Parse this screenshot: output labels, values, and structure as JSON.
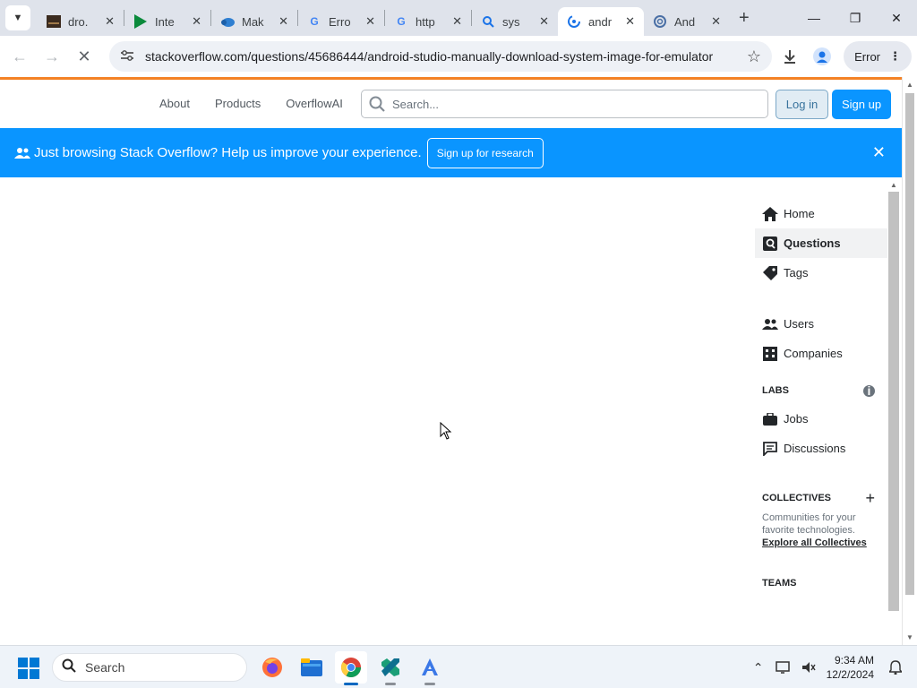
{
  "browser": {
    "tabs": [
      {
        "title": "dro.",
        "icon": "image-thumb-icon",
        "active": false
      },
      {
        "title": "Inte",
        "icon": "play-triangle-icon",
        "active": false
      },
      {
        "title": "Mak",
        "icon": "cloud-icon",
        "active": false
      },
      {
        "title": "Erro",
        "icon": "google-icon",
        "active": false
      },
      {
        "title": "http",
        "icon": "google-icon",
        "active": false
      },
      {
        "title": "sys",
        "icon": "search-icon",
        "active": false
      },
      {
        "title": "andr",
        "icon": "loading-spinner-icon",
        "active": true
      },
      {
        "title": "And",
        "icon": "spiral-icon",
        "active": false
      }
    ],
    "url": "stackoverflow.com/questions/45686444/android-studio-manually-download-system-image-for-emulator",
    "error_label": "Error"
  },
  "so_header": {
    "nav": [
      "About",
      "Products",
      "OverflowAI"
    ],
    "search_placeholder": "Search...",
    "login_label": "Log in",
    "signup_label": "Sign up"
  },
  "banner": {
    "message": "Just browsing Stack Overflow? Help us improve your experience.",
    "button_label": "Sign up for research"
  },
  "sidebar": {
    "top_items": [
      {
        "label": "Home",
        "icon": "home-icon",
        "active": false
      },
      {
        "label": "Questions",
        "icon": "question-icon",
        "active": true
      },
      {
        "label": "Tags",
        "icon": "tag-icon",
        "active": false
      }
    ],
    "mid_items": [
      {
        "label": "Users",
        "icon": "users-icon"
      },
      {
        "label": "Companies",
        "icon": "building-icon"
      }
    ],
    "labs_heading": "LABS",
    "labs_items": [
      {
        "label": "Jobs",
        "icon": "briefcase-icon"
      },
      {
        "label": "Discussions",
        "icon": "discussion-icon"
      }
    ],
    "collectives_heading": "COLLECTIVES",
    "collectives_desc": "Communities for your favorite technologies.",
    "collectives_link": "Explore all Collectives",
    "teams_heading": "TEAMS"
  },
  "taskbar": {
    "search_label": "Search",
    "time": "9:34 AM",
    "date": "12/2/2024"
  },
  "colors": {
    "so_orange": "#f48225",
    "so_blue": "#0a95ff",
    "chrome_strip": "#dfe3eb"
  }
}
